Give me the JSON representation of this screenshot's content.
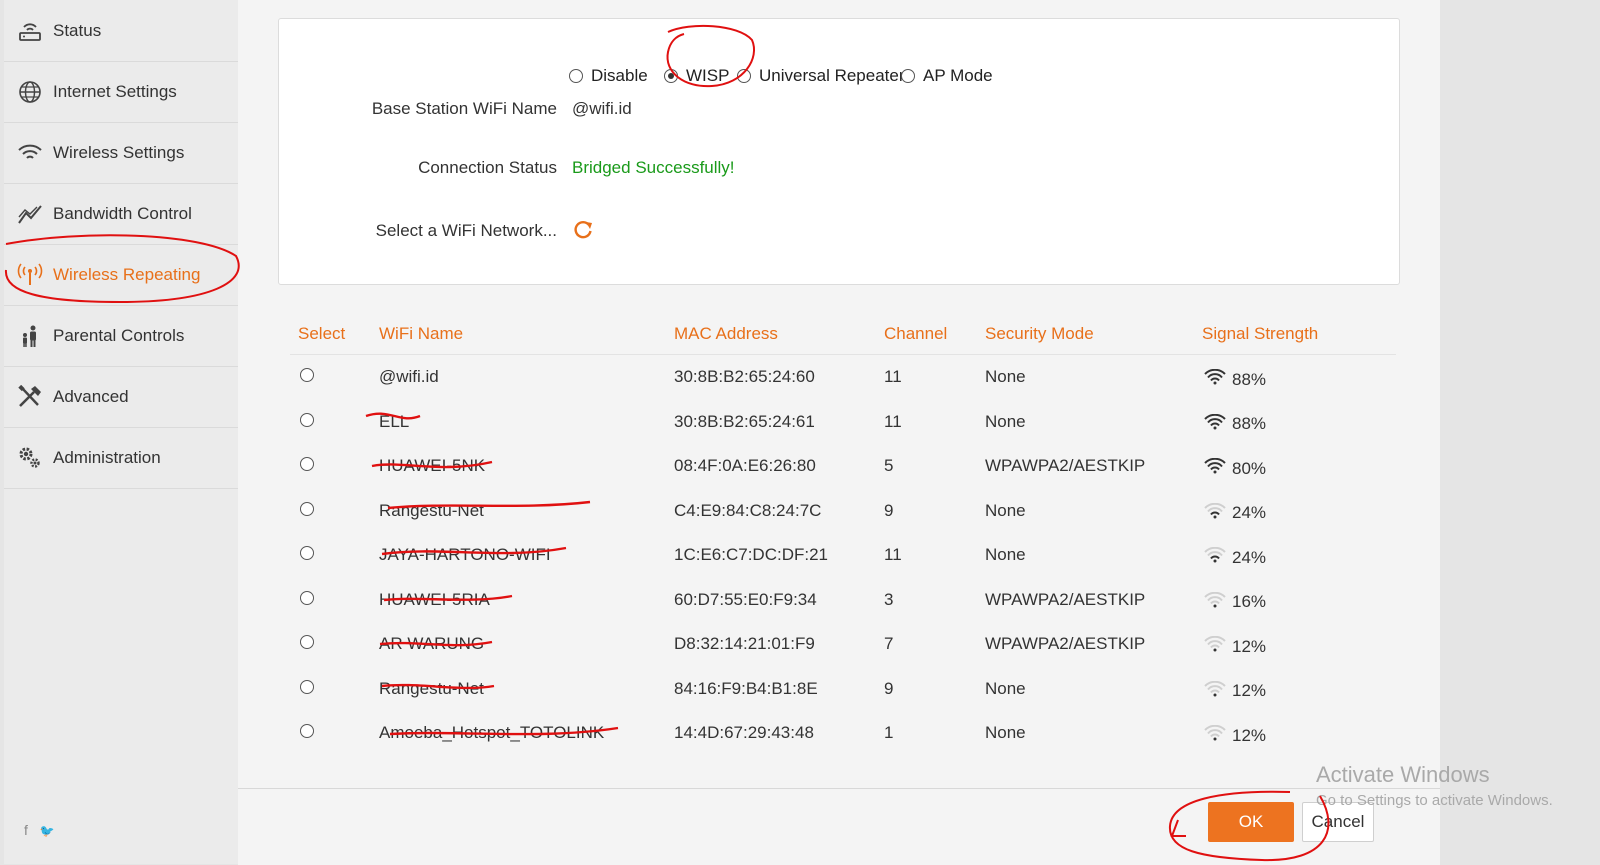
{
  "sidebar": {
    "items": [
      {
        "label": "Status",
        "icon": "router-icon"
      },
      {
        "label": "Internet Settings",
        "icon": "globe-icon"
      },
      {
        "label": "Wireless Settings",
        "icon": "wifi-icon"
      },
      {
        "label": "Bandwidth Control",
        "icon": "chart-line-icon"
      },
      {
        "label": "Wireless Repeating",
        "icon": "antenna-icon",
        "active": true
      },
      {
        "label": "Parental Controls",
        "icon": "family-icon"
      },
      {
        "label": "Advanced",
        "icon": "tools-icon"
      },
      {
        "label": "Administration",
        "icon": "gears-icon"
      }
    ],
    "social": {
      "facebook": "f",
      "twitter": "🐦"
    }
  },
  "mode": {
    "options": [
      "Disable",
      "WISP",
      "Universal Repeater",
      "AP Mode"
    ],
    "selected": "WISP"
  },
  "fields": {
    "base_station_label": "Base Station WiFi Name",
    "base_station_value": "@wifi.id",
    "connection_status_label": "Connection Status",
    "connection_status_value": "Bridged Successfully!",
    "select_network_label": "Select a WiFi Network..."
  },
  "table": {
    "headers": [
      "Select",
      "WiFi Name",
      "MAC Address",
      "Channel",
      "Security Mode",
      "Signal Strength"
    ],
    "rows": [
      {
        "name": "@wifi.id",
        "mac": "30:8B:B2:65:24:60",
        "channel": "11",
        "security": "None",
        "signal": "88%"
      },
      {
        "name": "ELL",
        "mac": "30:8B:B2:65:24:61",
        "channel": "11",
        "security": "None",
        "signal": "88%"
      },
      {
        "name": "HUAWEI-5NK",
        "mac": "08:4F:0A:E6:26:80",
        "channel": "5",
        "security": "WPAWPA2/AESTKIP",
        "signal": "80%"
      },
      {
        "name": "Rangestu-Net",
        "mac": "C4:E9:84:C8:24:7C",
        "channel": "9",
        "security": "None",
        "signal": "24%"
      },
      {
        "name": "JAYA-HARTONO-WIFI",
        "mac": "1C:E6:C7:DC:DF:21",
        "channel": "11",
        "security": "None",
        "signal": "24%"
      },
      {
        "name": "HUAWEI-5RIA",
        "mac": "60:D7:55:E0:F9:34",
        "channel": "3",
        "security": "WPAWPA2/AESTKIP",
        "signal": "16%"
      },
      {
        "name": "AR WARUNG",
        "mac": "D8:32:14:21:01:F9",
        "channel": "7",
        "security": "WPAWPA2/AESTKIP",
        "signal": "12%"
      },
      {
        "name": "Rangestu-Net",
        "mac": "84:16:F9:B4:B1:8E",
        "channel": "9",
        "security": "None",
        "signal": "12%"
      },
      {
        "name": "Amoeba_Hotspot_TOTOLINK",
        "mac": "14:4D:67:29:43:48",
        "channel": "1",
        "security": "None",
        "signal": "12%"
      }
    ]
  },
  "buttons": {
    "ok": "OK",
    "cancel": "Cancel"
  },
  "watermark": {
    "title": "Activate Windows",
    "subtitle": "Go to Settings to activate Windows."
  },
  "colors": {
    "accent": "#e8701a",
    "success": "#1a9a1a",
    "annotation": "#e01010"
  }
}
